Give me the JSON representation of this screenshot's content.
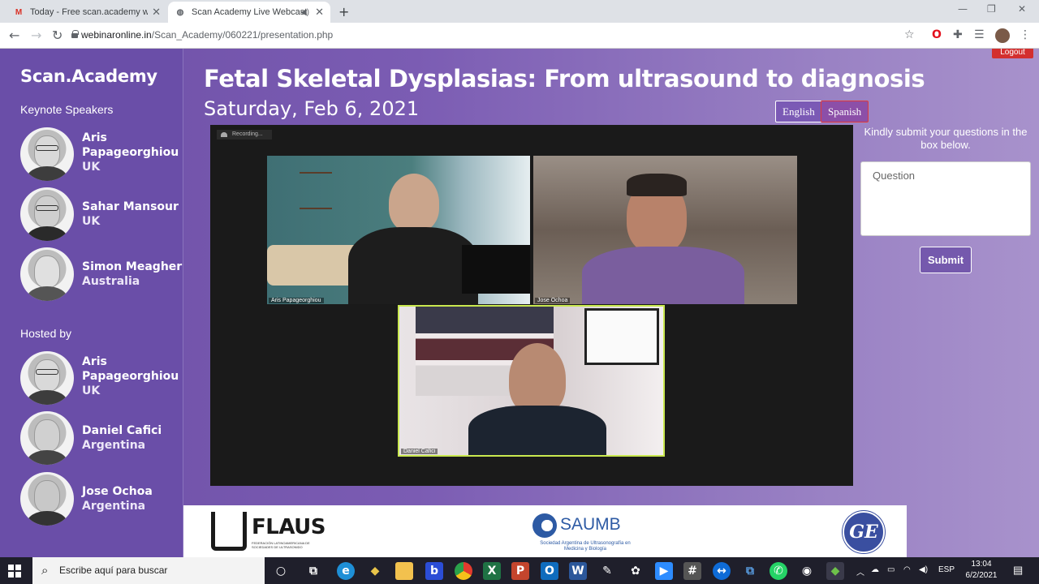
{
  "browser": {
    "tabs": [
      {
        "title": "Today - Free scan.academy webi",
        "icon": "gmail-icon"
      },
      {
        "title": "Scan Academy Live Webcast",
        "icon": "globe-icon",
        "active": true
      }
    ],
    "url_host": "webinaronline.in",
    "url_path": "/Scan_Academy/060221/presentation.php"
  },
  "sidebar": {
    "brand": "Scan.Academy",
    "keynote_heading": "Keynote Speakers",
    "keynote": [
      {
        "name": "Aris Papageorghiou",
        "country": "UK"
      },
      {
        "name": "Sahar Mansour",
        "country": "UK"
      },
      {
        "name": "Simon Meagher",
        "country": "Australia"
      }
    ],
    "hosted_heading": "Hosted by",
    "hosts": [
      {
        "name": "Aris Papageorghiou",
        "country": "UK"
      },
      {
        "name": "Daniel Cafici",
        "country": "Argentina"
      },
      {
        "name": "Jose Ochoa",
        "country": "Argentina"
      }
    ]
  },
  "header": {
    "title": "Fetal Skeletal Dysplasias: From ultrasound to diagnosis",
    "date": "Saturday, Feb 6, 2021",
    "lang_english": "English",
    "lang_spanish": "Spanish",
    "logout": "Logout"
  },
  "video": {
    "recording_label": "Recording...",
    "participants": [
      "Aris Papageorghiou",
      "Jose Ochoa",
      "Daniel Cafici"
    ]
  },
  "questions": {
    "prompt": "Kindly submit your questions in the box below.",
    "placeholder": "Question",
    "submit": "Submit"
  },
  "sponsors": {
    "flaus": "FLAUS",
    "flaus_sub": "FEDERACIÓN LATINOAMERICANA DE SOCIEDADES DE ULTRASONIDO",
    "saumb": "SAUMB",
    "saumb_sub": "Sociedad Argentina de Ultrasonografía en Medicina y Biología",
    "ge": "GE"
  },
  "taskbar": {
    "search_placeholder": "Escribe aquí para buscar",
    "lang": "ESP",
    "time": "13:04",
    "date": "6/2/2021"
  },
  "colors": {
    "accent_purple": "#6a4ea8",
    "spanish_border": "#e03a3a",
    "active_speaker_border": "#c9e84f",
    "logout_red": "#d32f2f"
  }
}
